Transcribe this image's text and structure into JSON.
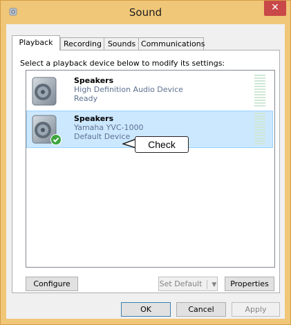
{
  "window": {
    "title": "Sound"
  },
  "tabs": [
    {
      "label": "Playback",
      "active": true
    },
    {
      "label": "Recording",
      "active": false
    },
    {
      "label": "Sounds",
      "active": false
    },
    {
      "label": "Communications",
      "active": false
    }
  ],
  "instruction": "Select a playback device below to modify its settings:",
  "devices": [
    {
      "name": "Speakers",
      "description": "High Definition Audio Device",
      "status": "Ready",
      "selected": false,
      "default": false
    },
    {
      "name": "Speakers",
      "description": "Yamaha YVC-1000",
      "status": "Default Device",
      "selected": true,
      "default": true
    }
  ],
  "callout": {
    "label": "Check"
  },
  "panel_buttons": {
    "configure": "Configure",
    "set_default": "Set Default",
    "properties": "Properties"
  },
  "dialog_buttons": {
    "ok": "OK",
    "cancel": "Cancel",
    "apply": "Apply"
  },
  "colors": {
    "titlebar": "#f0c678",
    "close": "#c94848",
    "selection": "#cce8ff",
    "device_text": "#5e7190"
  }
}
